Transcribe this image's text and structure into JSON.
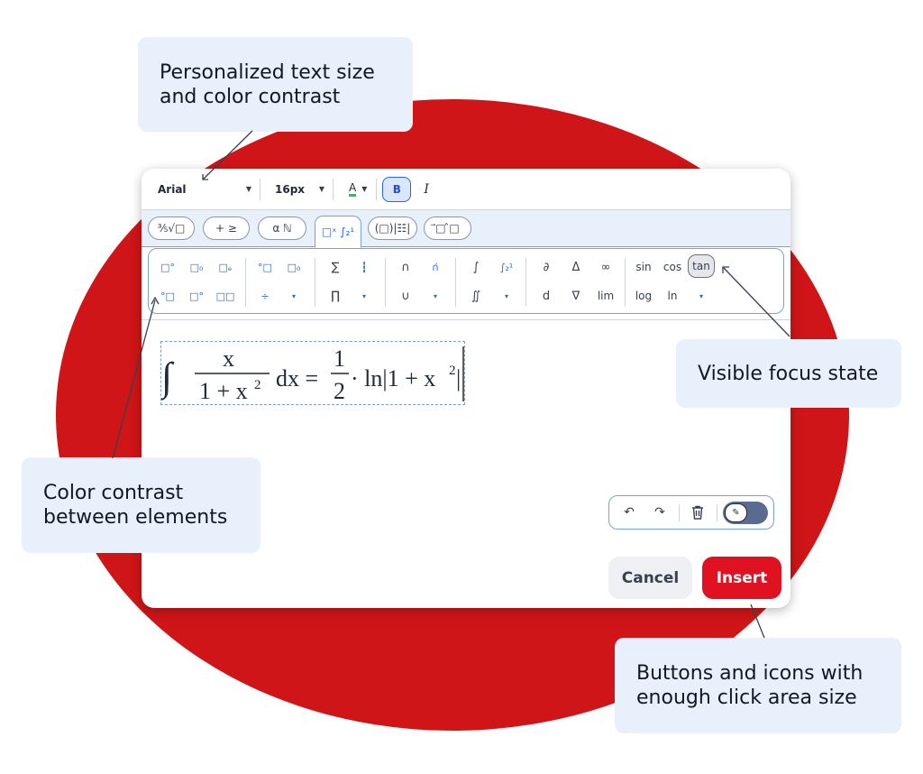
{
  "callouts": {
    "top": "Personalized text size\nand color contrast",
    "right": "Visible focus state",
    "left": "Color contrast\nbetween elements",
    "bottom": "Buttons and icons with\nenough click area size"
  },
  "font_bar": {
    "font_family": "Arial",
    "font_size": "16px",
    "color_label": "A",
    "bold_label": "B",
    "italic_label": "I"
  },
  "tabs": [
    {
      "label": "⅗√□"
    },
    {
      "label": "+ ≥"
    },
    {
      "label": "α ℕ"
    },
    {
      "label": "□ˣ ∫₂¹",
      "active": true
    },
    {
      "label": "(□)|☷|"
    },
    {
      "label": "⃗□ ̂□"
    }
  ],
  "palette": {
    "scripts": [
      "□°",
      "□₀",
      "□ₑ",
      "°□",
      "□°",
      "□□"
    ],
    "limits": [
      "°□",
      "□₀",
      "÷"
    ],
    "sum": "∑",
    "sum_limits": "┇",
    "product": "∏",
    "intersection": "∩",
    "intersection_limits": "∩̇",
    "union": "∪",
    "integral": "∫",
    "integral_limits": "∫₂¹",
    "double_integral": "∬",
    "partial": "∂",
    "delta": "Δ",
    "infinity": "∞",
    "d": "d",
    "nabla": "∇",
    "lim": "lim",
    "sin": "sin",
    "cos": "cos",
    "tan": "tan",
    "log": "log",
    "ln": "ln",
    "more_caret": "▾"
  },
  "formula": {
    "integral": "∫",
    "numerator": "x",
    "denominator": "1 + x",
    "denominator_exp": "2",
    "dx": "dx =",
    "half_num": "1",
    "half_den": "2",
    "rest": "· ln|1 + x",
    "rest_exp": "2",
    "end": "|"
  },
  "history": {
    "undo": "↶",
    "redo": "↷",
    "delete": "🗑",
    "toggle": "✎"
  },
  "buttons": {
    "cancel": "Cancel",
    "insert": "Insert"
  },
  "colors": {
    "background_circle": "#cf1517",
    "callout": "#e7f0fb",
    "accent_blue": "#2563eb",
    "insert_red": "#e01120",
    "cancel_gray": "#eef0f4"
  }
}
